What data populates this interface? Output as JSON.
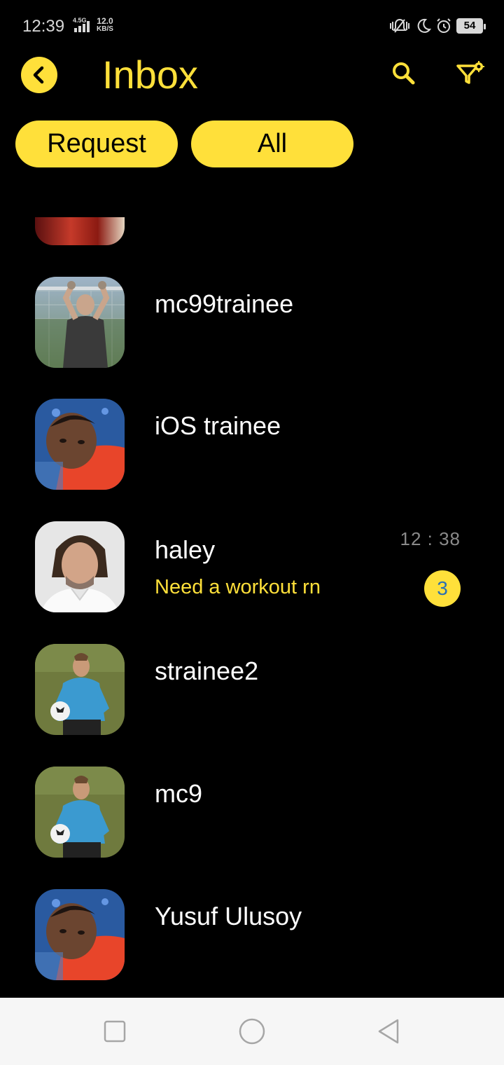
{
  "status_bar": {
    "time": "12:39",
    "network_type": "4.5G",
    "speed_value": "12.0",
    "speed_unit": "KB/S",
    "battery": "54"
  },
  "header": {
    "title": "Inbox",
    "back_icon": "chevron-left-icon",
    "search_icon": "search-icon",
    "filter_icon": "filter-settings-icon"
  },
  "chips": [
    {
      "label": "Request"
    },
    {
      "label": "All"
    }
  ],
  "conversations": [
    {
      "name": "mc99trainee",
      "avatar": "goalkeeper-photo"
    },
    {
      "name": "iOS trainee",
      "avatar": "athlete-red-shirt-photo"
    },
    {
      "name": "haley",
      "preview": "Need a workout rn",
      "time": "12 : 38",
      "unread": "3",
      "avatar": "man-white-shirt-photo"
    },
    {
      "name": "strainee2",
      "avatar": "player-blue-jacket-photo"
    },
    {
      "name": "mc9",
      "avatar": "player-blue-jacket-photo"
    },
    {
      "name": "Yusuf Ulusoy",
      "avatar": "athlete-red-shirt-photo"
    }
  ],
  "colors": {
    "accent": "#ffe03a",
    "background": "#000000",
    "badge_text": "#2b6fb3",
    "time_text": "#8a8a8a"
  }
}
